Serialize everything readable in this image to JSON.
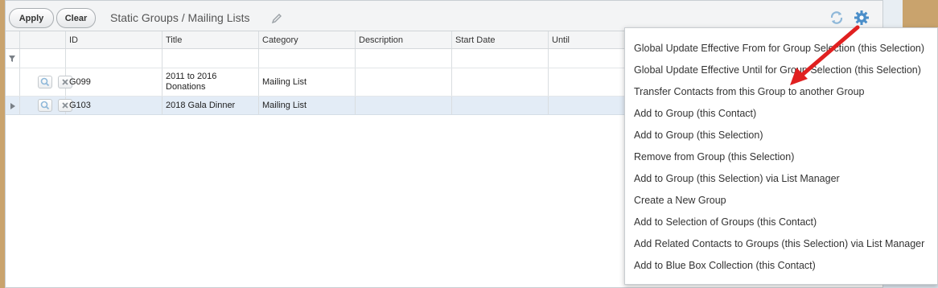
{
  "toolbar": {
    "apply_label": "Apply",
    "clear_label": "Clear",
    "title": "Static Groups / Mailing Lists"
  },
  "grid": {
    "columns": [
      "ID",
      "Title",
      "Category",
      "Description",
      "Start Date",
      "Until"
    ],
    "rows": [
      {
        "id": "G099",
        "title_line1": "2011 to 2016",
        "title_line2": "Donations",
        "category": "Mailing List",
        "description": "",
        "start_date": "",
        "until": ""
      },
      {
        "id": "G103",
        "title": "2018 Gala Dinner",
        "category": "Mailing List",
        "description": "",
        "start_date": "",
        "until": ""
      }
    ]
  },
  "menu": {
    "items": [
      "Global Update Effective From for Group Selection (this Selection)",
      "Global Update Effective Until for Group Selection (this Selection)",
      "Transfer Contacts from this Group to another Group",
      "Add to Group (this Contact)",
      "Add to Group (this Selection)",
      "Remove from Group (this Selection)",
      "Add to Group (this Selection) via List Manager",
      "Create a New Group",
      "Add to Selection of Groups (this Contact)",
      "Add Related Contacts to Groups (this Selection) via List Manager",
      "Add to Blue Box Collection (this Contact)"
    ]
  },
  "colors": {
    "accent_blue": "#4a8ec9",
    "arrow_red": "#e02020",
    "selected_row": "#e3ecf6"
  }
}
